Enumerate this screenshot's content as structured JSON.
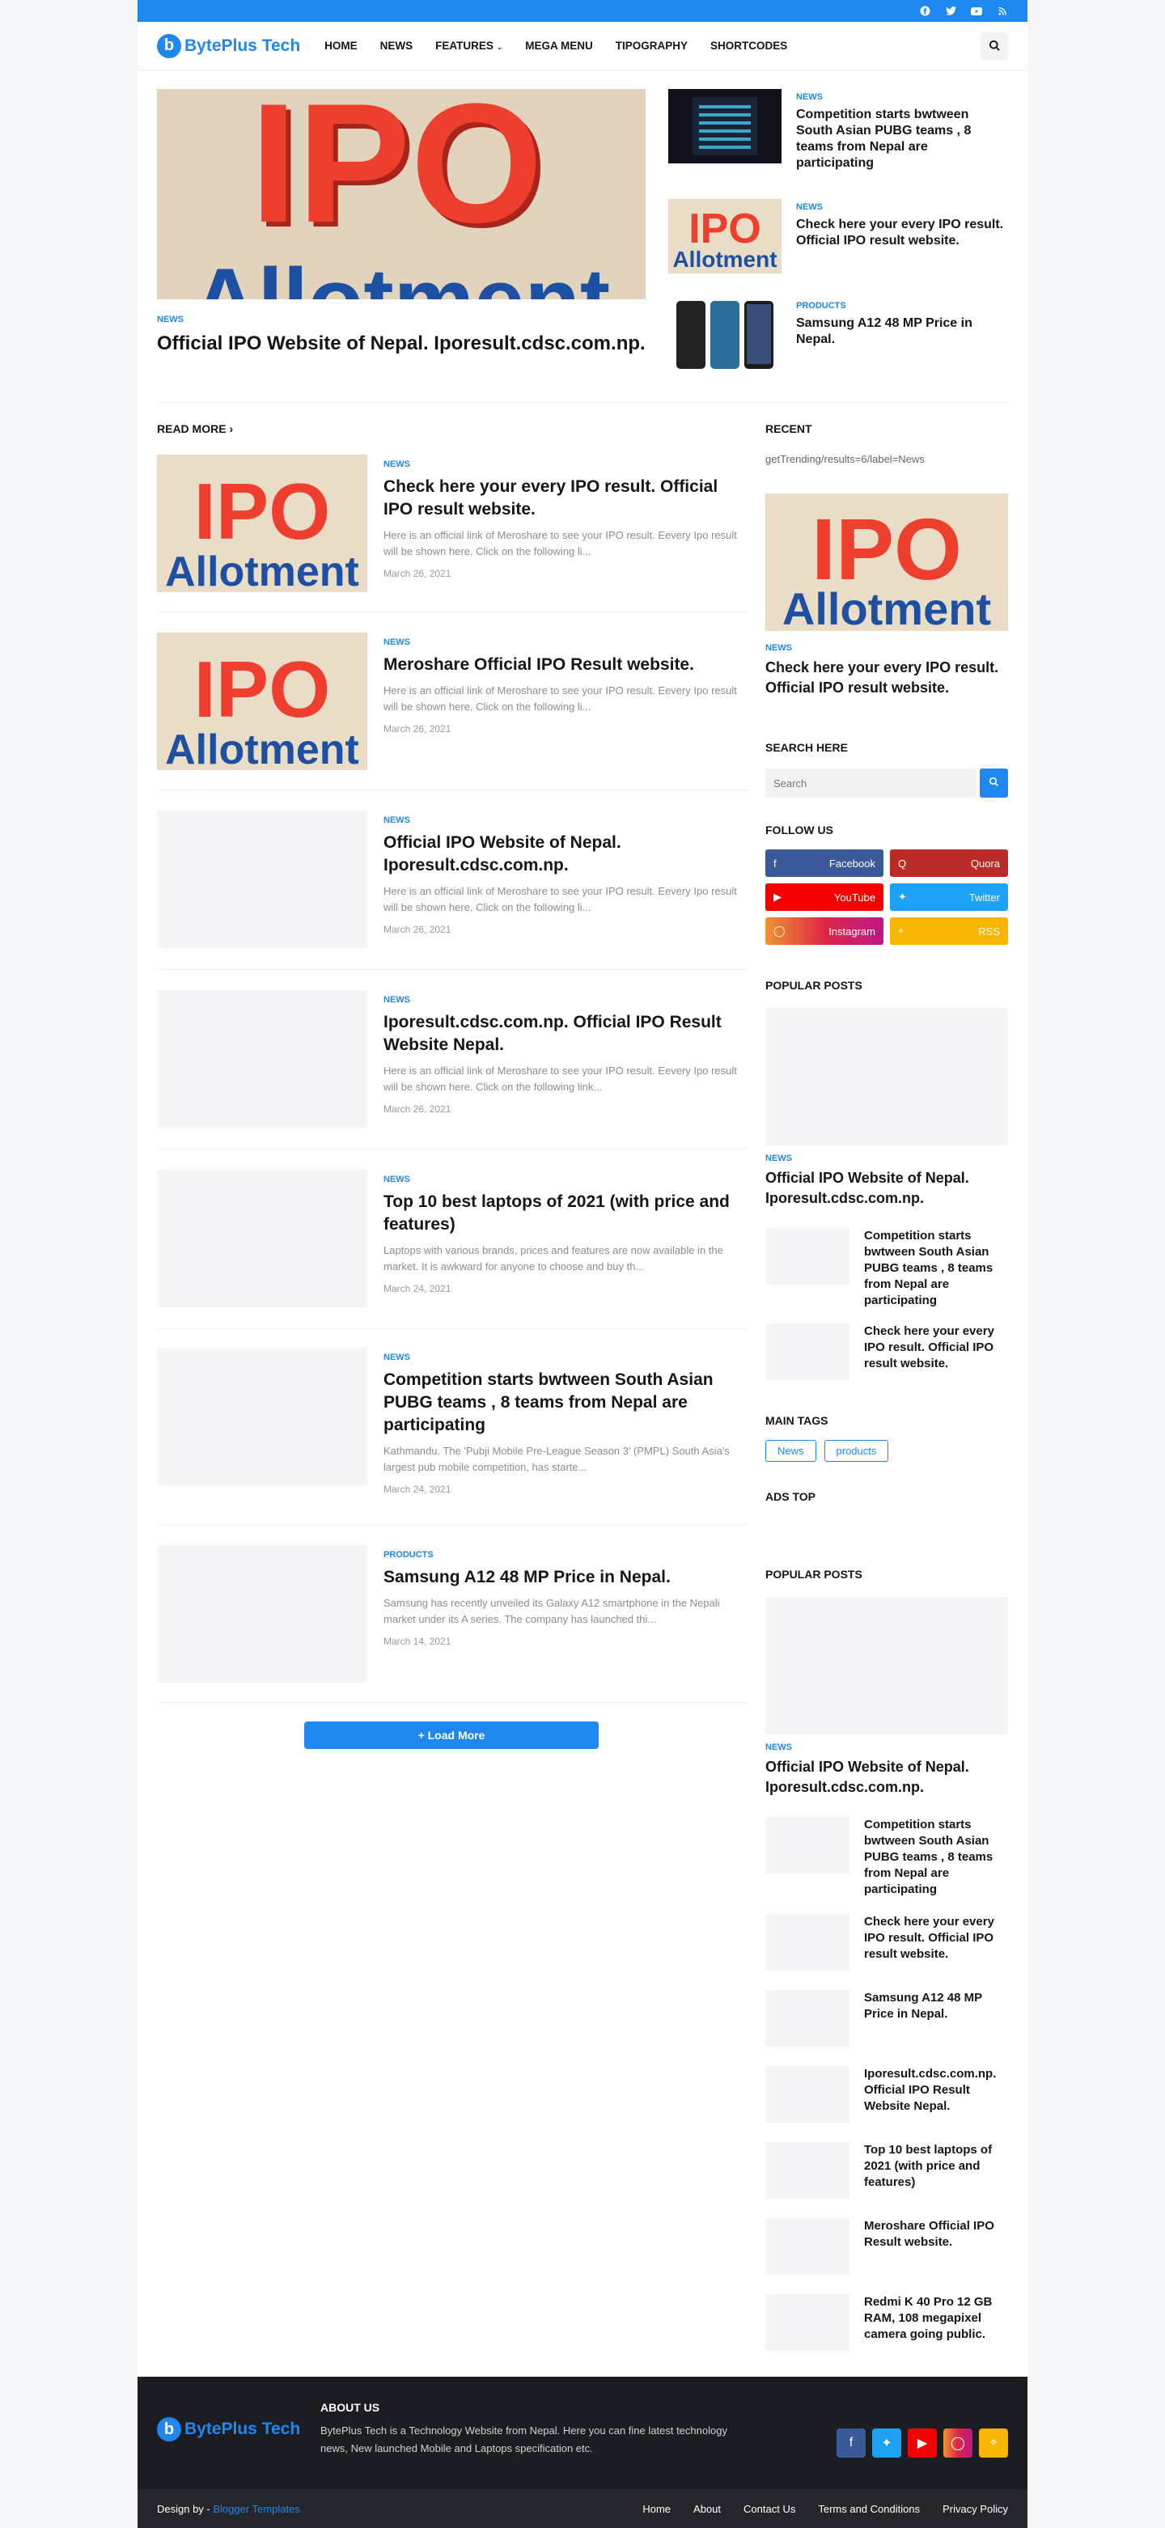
{
  "site": {
    "logo_letter": "b",
    "logo_text": "BytePlus Tech"
  },
  "nav": {
    "home": "HOME",
    "news": "NEWS",
    "features": "FEATURES",
    "mega": "MEGA MENU",
    "typo": "TIPOGRAPHY",
    "shortcodes": "SHORTCODES"
  },
  "hero": {
    "img_top": "IPO",
    "img_bottom": "Allotment",
    "category": "NEWS",
    "title": "Official IPO Website of Nepal. Iporesult.cdsc.com.np."
  },
  "side_hero": [
    {
      "category": "NEWS",
      "title": "Competition starts bwtween South Asian PUBG teams , 8 teams from Nepal are participating"
    },
    {
      "category": "NEWS",
      "title": "Check here your every IPO result. Official IPO result website."
    },
    {
      "category": "PRODUCTS",
      "title": "Samsung A12 48 MP Price in Nepal."
    }
  ],
  "main": {
    "read_more": "READ MORE",
    "posts": [
      {
        "category": "NEWS",
        "title": "Check here your every IPO result. Official IPO result website.",
        "excerpt": "Here is an official link of Meroshare to see your IPO result. Eevery Ipo result will be shown here.  Click on the following li...",
        "date": "March 26, 2021"
      },
      {
        "category": "NEWS",
        "title": "Meroshare Official IPO Result website.",
        "excerpt": "Here is an official link of Meroshare to see your IPO result. Eevery Ipo result will be shown here.  Click on the following li...",
        "date": "March 26, 2021"
      },
      {
        "category": "NEWS",
        "title": "Official IPO Website of Nepal. Iporesult.cdsc.com.np.",
        "excerpt": "Here is an official link of Meroshare to see your IPO result. Eevery Ipo result will be shown here.  Click on the following li...",
        "date": "March 26, 2021"
      },
      {
        "category": "NEWS",
        "title": "Iporesult.cdsc.com.np. Official IPO Result Website Nepal.",
        "excerpt": "Here is an official link of Meroshare to see your IPO result. Eevery Ipo result will be shown here.  Click on the following link...",
        "date": "March 26, 2021"
      },
      {
        "category": "NEWS",
        "title": "Top 10 best laptops of 2021 (with price and features)",
        "excerpt": "Laptops with various brands, prices and features are now available in the market.  It is awkward for anyone to choose and buy th...",
        "date": "March 24, 2021"
      },
      {
        "category": "NEWS",
        "title": "Competition starts bwtween South Asian PUBG teams , 8 teams from Nepal are participating",
        "excerpt": "Kathmandu.  The 'Pubji Mobile Pre-League Season 3' (PMPL) South Asia's largest pub mobile competition, has starte...",
        "date": "March 24, 2021"
      },
      {
        "category": "PRODUCTS",
        "title": "Samsung A12 48 MP Price in Nepal.",
        "excerpt": "Samsung has recently unveiled its Galaxy A12 smartphone in the Nepali market under its A series.  The company has launched thi...",
        "date": "March 14, 2021"
      }
    ],
    "load_more": "+ Load More"
  },
  "sidebar": {
    "recent_title": "RECENT",
    "recent_label": "getTrending/results=6/label=News",
    "recent_category": "NEWS",
    "recent_post": "Check here your every IPO result. Official IPO result website.",
    "search_title": "SEARCH HERE",
    "search_placeholder": "Search",
    "follow_title": "FOLLOW US",
    "follow": {
      "facebook": "Facebook",
      "quora": "Quora",
      "youtube": "YouTube",
      "twitter": "Twitter",
      "instagram": "Instagram",
      "rss": "RSS"
    },
    "popular_title": "POPULAR POSTS",
    "popular_category": "NEWS",
    "popular_big": "Official IPO Website of Nepal. Iporesult.cdsc.com.np.",
    "popular_items": [
      "Competition starts bwtween South Asian PUBG teams , 8 teams from Nepal are participating",
      "Check here your every IPO result. Official IPO result website."
    ],
    "tags_title": "MAIN TAGS",
    "tags": [
      "News",
      "products"
    ],
    "ads_title": "ADS TOP",
    "popular2_title": "POPULAR POSTS",
    "popular2_category": "NEWS",
    "popular2_big": "Official IPO Website of Nepal. Iporesult.cdsc.com.np.",
    "popular2_items": [
      "Competition starts bwtween South Asian PUBG teams , 8 teams from Nepal are participating",
      "Check here your every IPO result. Official IPO result website.",
      "Samsung A12 48 MP Price in Nepal.",
      "Iporesult.cdsc.com.np. Official IPO Result Website Nepal.",
      "Top 10 best laptops of 2021 (with price and features)",
      "Meroshare Official IPO Result website.",
      "Redmi K 40 Pro 12 GB RAM, 108 megapixel camera going public."
    ]
  },
  "footer": {
    "about_title": "ABOUT US",
    "about_text": "BytePlus Tech is a Technology Website from Nepal. Here you can fine latest technology news, New launched Mobile and Laptops specification etc.",
    "credit_prefix": "Design by - ",
    "credit_link": "Blogger Templates",
    "links": [
      "Home",
      "About",
      "Contact Us",
      "Terms and Conditions",
      "Privacy Policy"
    ]
  }
}
